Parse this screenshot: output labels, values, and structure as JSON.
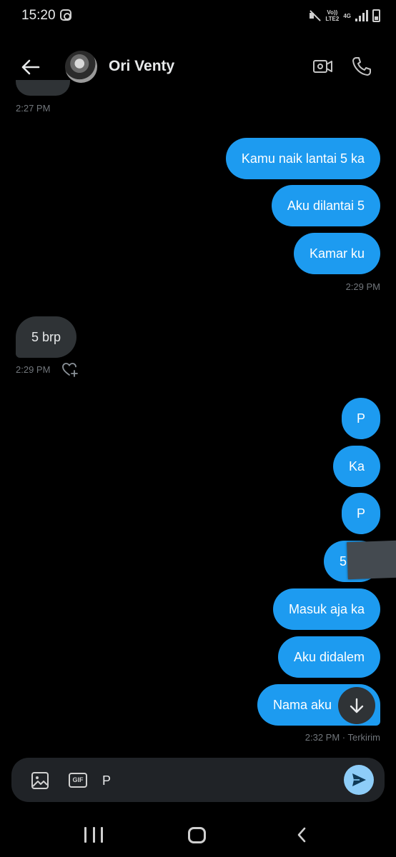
{
  "status_bar": {
    "time": "15:20",
    "network_lte": "Vo))\nLTE2",
    "network_4g": "4G"
  },
  "header": {
    "contact_name": "Ori Venty"
  },
  "messages": [
    {
      "dir": "out",
      "text": "Kamu naik lantai 5 ka"
    },
    {
      "dir": "out",
      "text": "Aku dilantai 5"
    },
    {
      "dir": "out",
      "text": "Kamar ku"
    },
    {
      "dir": "in",
      "text": "5 brp"
    },
    {
      "dir": "out",
      "text": "P"
    },
    {
      "dir": "out",
      "text": "Ka"
    },
    {
      "dir": "out",
      "text": "P"
    },
    {
      "dir": "out",
      "text": "5"
    },
    {
      "dir": "out",
      "text": "Masuk aja ka"
    },
    {
      "dir": "out",
      "text": "Aku didalem"
    },
    {
      "dir": "out",
      "text": "Nama aku"
    }
  ],
  "timestamps": {
    "t1": "2:27 PM",
    "t2": "2:29 PM",
    "t3": "2:29 PM",
    "t4": "2:32 PM · Terkirim"
  },
  "composer": {
    "gif_label": "GIF",
    "input_value": "P"
  },
  "icons": {
    "back": "back-arrow-icon",
    "video": "video-call-icon",
    "phone": "phone-call-icon",
    "like": "heart-plus-icon",
    "scroll": "arrow-down-icon",
    "image": "image-icon",
    "send": "send-icon"
  },
  "colors": {
    "background": "#000000",
    "outgoing_bubble": "#1d9bf0",
    "incoming_bubble": "#2f3336",
    "timestamp": "#71767b",
    "composer_bg": "#202327",
    "send_button": "#8ecdf8"
  }
}
